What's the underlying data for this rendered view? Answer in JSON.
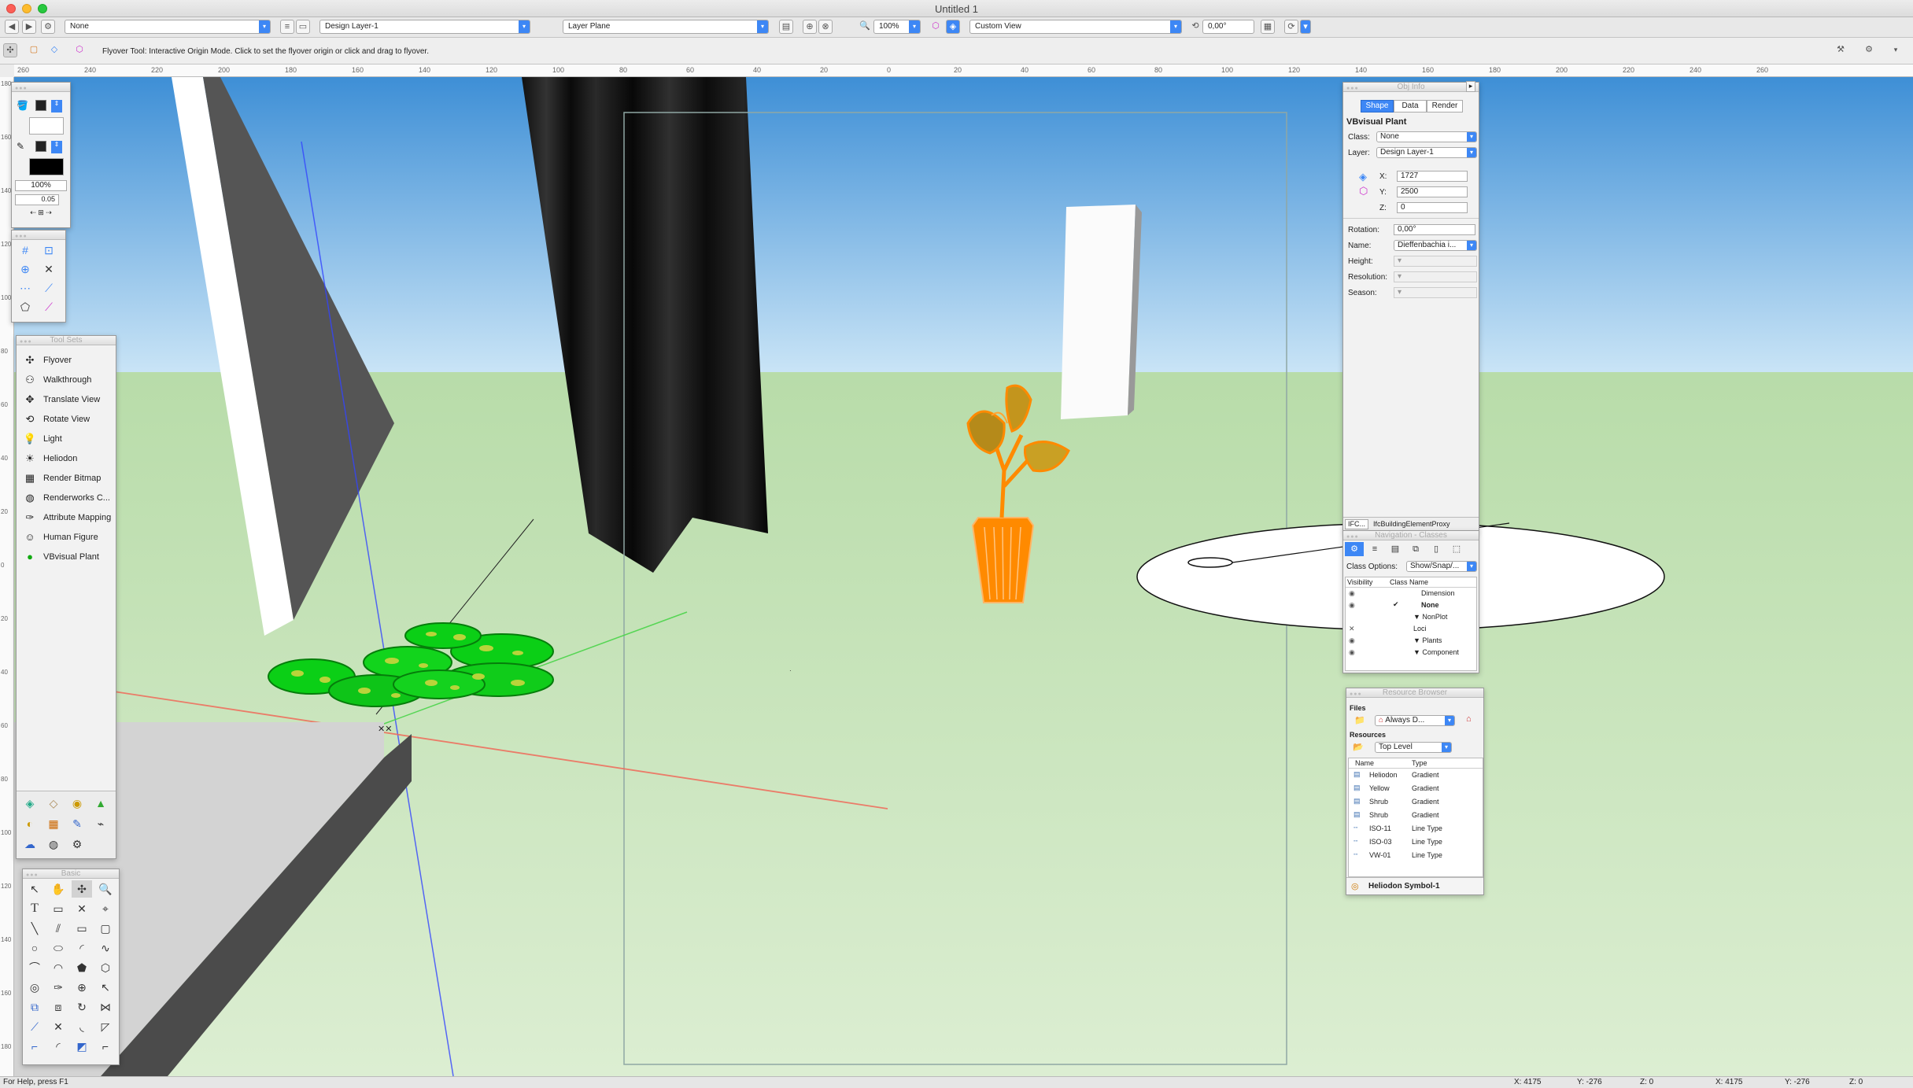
{
  "window": {
    "title": "Untitled 1"
  },
  "toolbar": {
    "class_select": "None",
    "layer_select": "Design Layer-1",
    "plane_select": "Layer Plane",
    "zoom": "100%",
    "view_select": "Custom View",
    "angle": "0,00°"
  },
  "mode_bar": {
    "help_text": "Flyover Tool: Interactive Origin Mode. Click to set the flyover origin or click and drag to flyover."
  },
  "ruler": {
    "h_ticks": [
      "260",
      "240",
      "220",
      "200",
      "180",
      "160",
      "140",
      "120",
      "100",
      "80",
      "60",
      "40",
      "20",
      "0",
      "20",
      "40",
      "60",
      "80",
      "100",
      "120",
      "140",
      "160",
      "180",
      "200",
      "220",
      "240",
      "260"
    ],
    "v_ticks": [
      "180",
      "160",
      "140",
      "120",
      "100",
      "80",
      "60",
      "40",
      "20",
      "0",
      "20",
      "40",
      "60",
      "80",
      "100",
      "120",
      "140",
      "160",
      "180"
    ]
  },
  "attributes_palette": {
    "opacity": "100%",
    "line_weight": "0.05"
  },
  "tool_sets": {
    "title": "Tool Sets",
    "items": [
      {
        "label": "Flyover",
        "icon": "flyover-icon"
      },
      {
        "label": "Walkthrough",
        "icon": "walkthrough-icon"
      },
      {
        "label": "Translate View",
        "icon": "translate-view-icon"
      },
      {
        "label": "Rotate View",
        "icon": "rotate-view-icon"
      },
      {
        "label": "Light",
        "icon": "light-icon"
      },
      {
        "label": "Heliodon",
        "icon": "heliodon-icon"
      },
      {
        "label": "Render Bitmap",
        "icon": "render-bitmap-icon"
      },
      {
        "label": "Renderworks C...",
        "icon": "renderworks-camera-icon"
      },
      {
        "label": "Attribute Mapping",
        "icon": "attribute-mapping-icon"
      },
      {
        "label": "Human Figure",
        "icon": "human-figure-icon"
      },
      {
        "label": "VBvisual Plant",
        "icon": "vbvisual-plant-icon"
      }
    ]
  },
  "basic_palette": {
    "title": "Basic",
    "text_tool_label": "T"
  },
  "obj_info": {
    "title": "Obj Info",
    "tabs": [
      "Shape",
      "Data",
      "Render"
    ],
    "object_type": "VBvisual Plant",
    "class_label": "Class:",
    "class_value": "None",
    "layer_label": "Layer:",
    "layer_value": "Design Layer-1",
    "x_label": "X:",
    "x": "1727",
    "y_label": "Y:",
    "y": "2500",
    "z_label": "Z:",
    "z": "0",
    "rotation_label": "Rotation:",
    "rotation": "0,00°",
    "name_label": "Name:",
    "name": "Dieffenbachia i...",
    "height_label": "Height:",
    "resolution_label": "Resolution:",
    "season_label": "Season:",
    "ifc_button": "IFC...",
    "ifc_text": "IfcBuildingElementProxy"
  },
  "navigation": {
    "title": "Navigation - Classes",
    "class_options_label": "Class Options:",
    "class_options_value": "Show/Snap/...",
    "col_visibility": "Visibility",
    "col_class_name": "Class Name",
    "rows": [
      {
        "name": "Dimension",
        "vis": "◉"
      },
      {
        "name": "None",
        "vis": "◉"
      },
      {
        "name": "▼ NonPlot",
        "vis": ""
      },
      {
        "name": "Loci",
        "vis": "✕"
      },
      {
        "name": "▼ Plants",
        "vis": "◉"
      },
      {
        "name": "▼ Component",
        "vis": "◉"
      }
    ]
  },
  "resource_browser": {
    "title": "Resource Browser",
    "files_label": "Files",
    "files_value": "Always D...",
    "resources_label": "Resources",
    "level_value": "Top Level",
    "col_name": "Name",
    "col_type": "Type",
    "rows": [
      {
        "name": "Heliodon",
        "type": "Gradient"
      },
      {
        "name": "Yellow",
        "type": "Gradient"
      },
      {
        "name": "Shrub",
        "type": "Gradient"
      },
      {
        "name": "Shrub",
        "type": "Gradient"
      },
      {
        "name": "ISO-11",
        "type": "Line Type"
      },
      {
        "name": "ISO-03",
        "type": "Line Type"
      },
      {
        "name": "VW-01",
        "type": "Line Type"
      }
    ],
    "selected": "Heliodon Symbol-1"
  },
  "status": {
    "help": "For Help, press F1",
    "x1": "X: 4175",
    "y1": "Y: -276",
    "z1": "Z: 0",
    "x2": "X: 4175",
    "y2": "Y: -276",
    "z2": "Z: 0"
  },
  "colors": {
    "accent": "#3d87f5",
    "sky": "#a9d0ee",
    "ground": "#c6e3bc",
    "plant_selection": "#ff8800"
  }
}
